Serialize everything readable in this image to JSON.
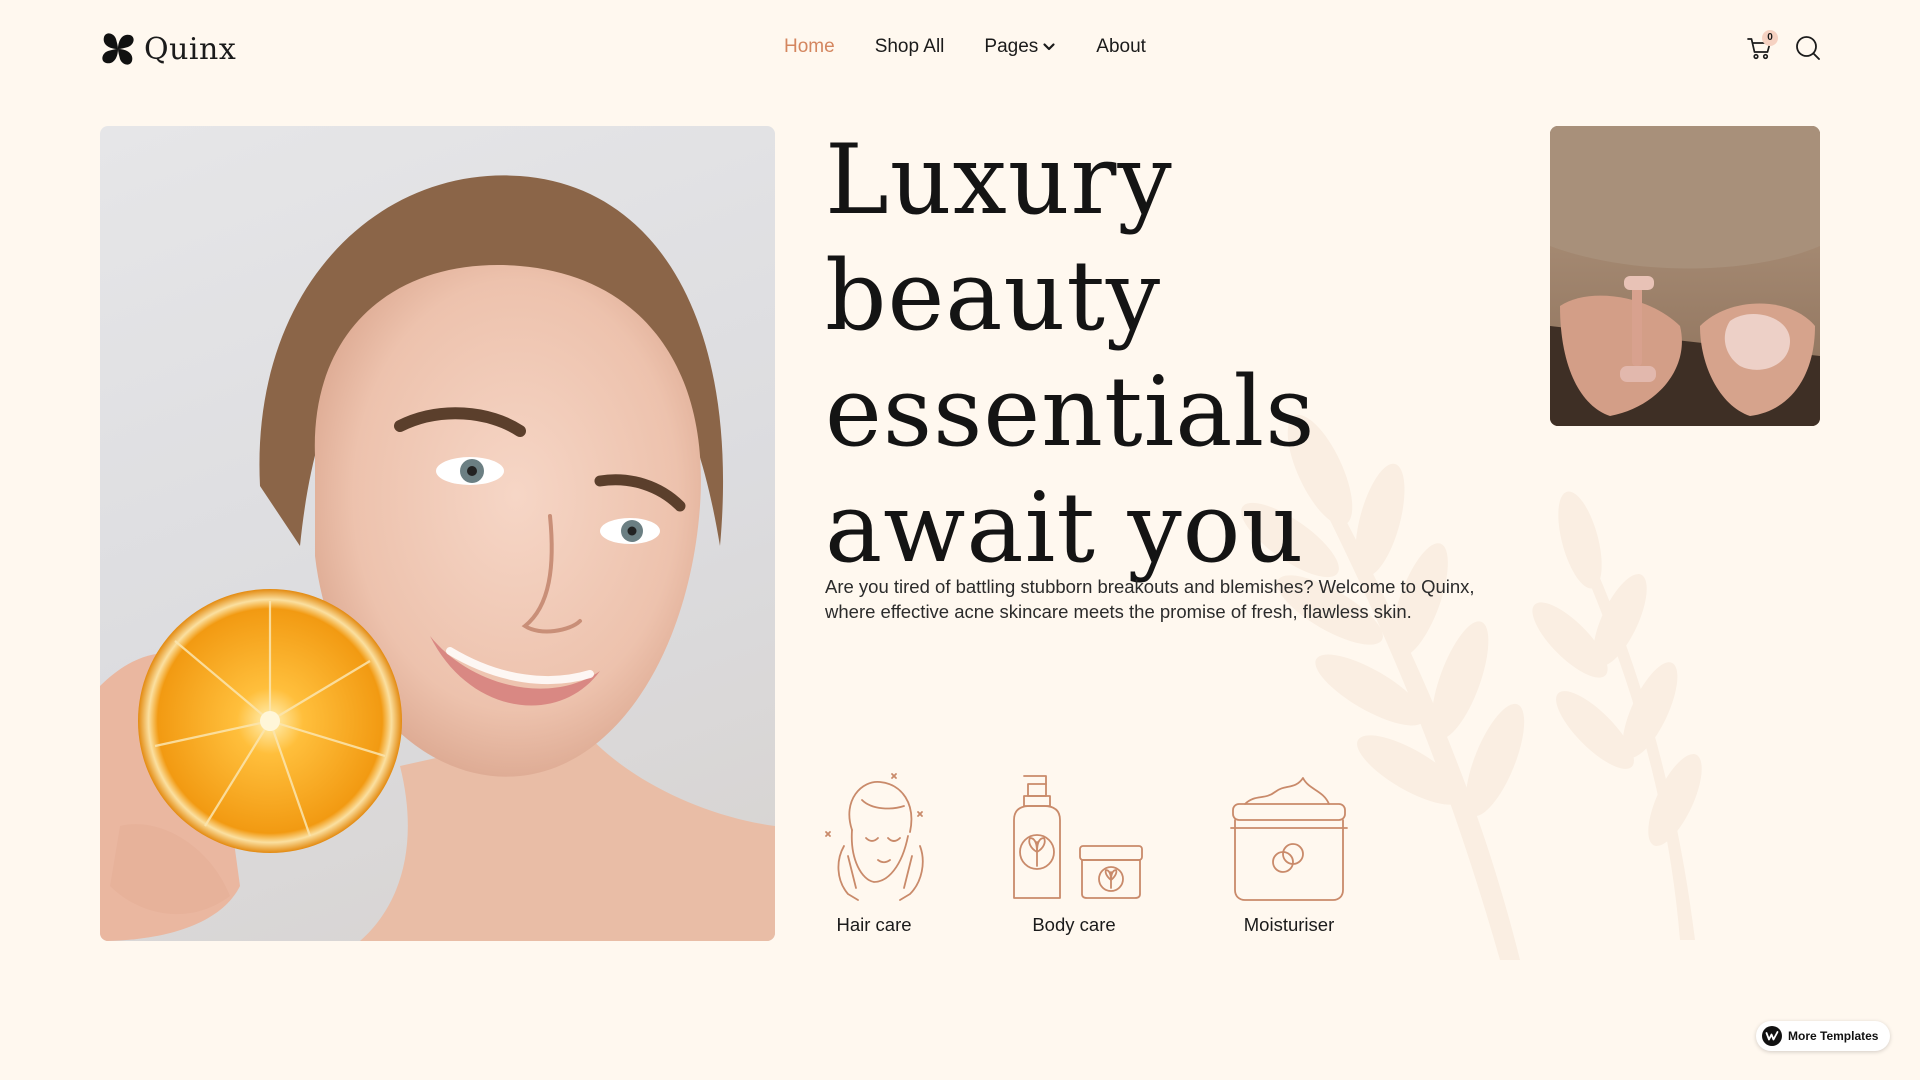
{
  "brand": {
    "name": "Quinx"
  },
  "nav": {
    "items": [
      {
        "label": "Home",
        "active": true
      },
      {
        "label": "Shop All",
        "active": false
      },
      {
        "label": "Pages",
        "active": false,
        "has_dropdown": true
      },
      {
        "label": "About",
        "active": false
      }
    ]
  },
  "header": {
    "cart_count": "0",
    "cart_icon": "cart-icon",
    "search_icon": "search-icon"
  },
  "hero": {
    "headline": "Luxury beauty essentials await you",
    "lead": "Are you tired of battling stubborn breakouts and blemishes? Welcome to Quinx, where effective acne skincare meets the promise of fresh, flawless skin."
  },
  "categories": [
    {
      "label": "Hair care",
      "icon": "hair-care-icon"
    },
    {
      "label": "Body care",
      "icon": "body-care-icon"
    },
    {
      "label": "Moisturiser",
      "icon": "moisturiser-icon"
    }
  ],
  "badge": {
    "label": "More Templates"
  },
  "colors": {
    "background": "#fff8ef",
    "accent": "#d4865f",
    "text": "#1b1b1b",
    "icon_line": "#c98a6a"
  }
}
